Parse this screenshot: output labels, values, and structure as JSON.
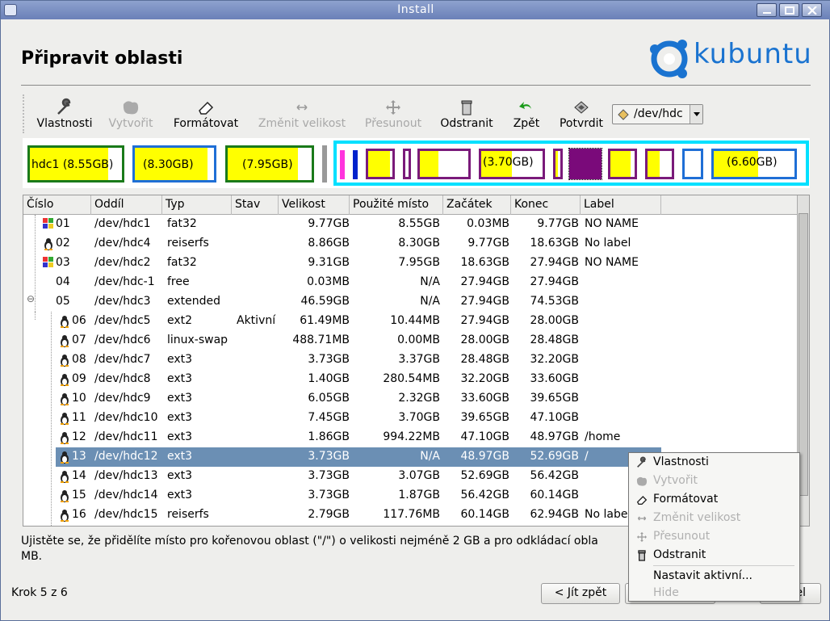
{
  "window": {
    "title": "Install"
  },
  "page": {
    "heading": "Připravit oblasti",
    "logo_text": "kubuntu"
  },
  "toolbar": {
    "items": [
      {
        "label": "Vlastnosti",
        "icon": "wrench-icon",
        "enabled": true
      },
      {
        "label": "Vytvořit",
        "icon": "create-partition-icon",
        "enabled": false
      },
      {
        "label": "Formátovat",
        "icon": "eraser-icon",
        "enabled": true
      },
      {
        "label": "Změnit velikost",
        "icon": "resize-icon",
        "enabled": false
      },
      {
        "label": "Přesunout",
        "icon": "move-icon",
        "enabled": false
      },
      {
        "label": "Odstranit",
        "icon": "trash-icon",
        "enabled": true
      },
      {
        "label": "Zpět",
        "icon": "undo-icon",
        "enabled": true
      },
      {
        "label": "Potvrdit",
        "icon": "apply-icon",
        "enabled": true
      }
    ],
    "device": "/dev/hdc"
  },
  "partition_map": {
    "labels": [
      "hdc1 (8.55GB)",
      "(8.30GB)",
      "(7.95GB)",
      "(3.70GB)",
      "(6.60GB)"
    ]
  },
  "table": {
    "columns": [
      "Číslo",
      "Oddíl",
      "Typ",
      "Stav",
      "Velikost",
      "Použité místo",
      "Začátek",
      "Konec",
      "Label"
    ],
    "rows": [
      {
        "num": "01",
        "part": "/dev/hdc1",
        "type": "fat32",
        "state": "",
        "size": "9.77GB",
        "used": "8.55GB",
        "start": "0.03MB",
        "end": "9.77GB",
        "label": "NO NAME",
        "icon": "windows-icon"
      },
      {
        "num": "02",
        "part": "/dev/hdc4",
        "type": "reiserfs",
        "state": "",
        "size": "8.86GB",
        "used": "8.30GB",
        "start": "9.77GB",
        "end": "18.63GB",
        "label": "No label",
        "icon": "linux-icon"
      },
      {
        "num": "03",
        "part": "/dev/hdc2",
        "type": "fat32",
        "state": "",
        "size": "9.31GB",
        "used": "7.95GB",
        "start": "18.63GB",
        "end": "27.94GB",
        "label": "NO NAME",
        "icon": "windows-icon"
      },
      {
        "num": "04",
        "part": "/dev/hdc-1",
        "type": "free",
        "state": "",
        "size": "0.03MB",
        "used": "N/A",
        "start": "27.94GB",
        "end": "27.94GB",
        "label": "",
        "icon": ""
      },
      {
        "num": "05",
        "part": "/dev/hdc3",
        "type": "extended",
        "state": "",
        "size": "46.59GB",
        "used": "N/A",
        "start": "27.94GB",
        "end": "74.53GB",
        "label": "",
        "icon": ""
      },
      {
        "num": "06",
        "part": "/dev/hdc5",
        "type": "ext2",
        "state": "Aktivní",
        "size": "61.49MB",
        "used": "10.44MB",
        "start": "27.94GB",
        "end": "28.00GB",
        "label": "",
        "icon": "linux-icon"
      },
      {
        "num": "07",
        "part": "/dev/hdc6",
        "type": "linux-swap",
        "state": "",
        "size": "488.71MB",
        "used": "0.00MB",
        "start": "28.00GB",
        "end": "28.48GB",
        "label": "",
        "icon": "linux-icon"
      },
      {
        "num": "08",
        "part": "/dev/hdc7",
        "type": "ext3",
        "state": "",
        "size": "3.73GB",
        "used": "3.37GB",
        "start": "28.48GB",
        "end": "32.20GB",
        "label": "",
        "icon": "linux-icon"
      },
      {
        "num": "09",
        "part": "/dev/hdc8",
        "type": "ext3",
        "state": "",
        "size": "1.40GB",
        "used": "280.54MB",
        "start": "32.20GB",
        "end": "33.60GB",
        "label": "",
        "icon": "linux-icon"
      },
      {
        "num": "10",
        "part": "/dev/hdc9",
        "type": "ext3",
        "state": "",
        "size": "6.05GB",
        "used": "2.32GB",
        "start": "33.60GB",
        "end": "39.65GB",
        "label": "",
        "icon": "linux-icon"
      },
      {
        "num": "11",
        "part": "/dev/hdc10",
        "type": "ext3",
        "state": "",
        "size": "7.45GB",
        "used": "3.70GB",
        "start": "39.65GB",
        "end": "47.10GB",
        "label": "",
        "icon": "linux-icon"
      },
      {
        "num": "12",
        "part": "/dev/hdc11",
        "type": "ext3",
        "state": "",
        "size": "1.86GB",
        "used": "994.22MB",
        "start": "47.10GB",
        "end": "48.97GB",
        "label": "/home",
        "icon": "linux-icon"
      },
      {
        "num": "13",
        "part": "/dev/hdc12",
        "type": "ext3",
        "state": "",
        "size": "3.73GB",
        "used": "N/A",
        "start": "48.97GB",
        "end": "52.69GB",
        "label": "/",
        "icon": "linux-icon"
      },
      {
        "num": "14",
        "part": "/dev/hdc13",
        "type": "ext3",
        "state": "",
        "size": "3.73GB",
        "used": "3.07GB",
        "start": "52.69GB",
        "end": "56.42GB",
        "label": "",
        "icon": "linux-icon"
      },
      {
        "num": "15",
        "part": "/dev/hdc14",
        "type": "ext3",
        "state": "",
        "size": "3.73GB",
        "used": "1.87GB",
        "start": "56.42GB",
        "end": "60.14GB",
        "label": "",
        "icon": "linux-icon"
      },
      {
        "num": "16",
        "part": "/dev/hdc15",
        "type": "reiserfs",
        "state": "",
        "size": "2.79GB",
        "used": "117.76MB",
        "start": "60.14GB",
        "end": "62.94GB",
        "label": "No label",
        "icon": "linux-icon"
      }
    ]
  },
  "note": "Ujistěte se, že přidělíte místo pro kořenovou oblast (\"/\") o    velikosti nejméně 2 GB a pro odkládací obla",
  "note_line2": "MB.",
  "footer": {
    "step": "Krok 5 z 6",
    "back": "< Jít zpět",
    "next": "",
    "cancel_fragment": "el"
  },
  "context_menu": {
    "items": [
      {
        "label": "Vlastnosti",
        "icon": "wrench-icon",
        "enabled": true
      },
      {
        "label": "Vytvořit",
        "icon": "create-partition-icon",
        "enabled": false
      },
      {
        "label": "Formátovat",
        "icon": "eraser-icon",
        "enabled": true
      },
      {
        "label": "Změnit velikost",
        "icon": "resize-icon",
        "enabled": false
      },
      {
        "label": "Přesunout",
        "icon": "move-icon",
        "enabled": false
      },
      {
        "label": "Odstranit",
        "icon": "trash-icon",
        "enabled": true
      },
      {
        "label": "Nastavit aktivní...",
        "icon": "",
        "enabled": true
      },
      {
        "label": "Hide",
        "icon": "",
        "enabled": false
      }
    ]
  },
  "colors": {
    "selection": "#6b8fb4",
    "extended_border": "#00e0ff",
    "fat_border": "#1a7a1a",
    "reiser_border": "#1f6fd6",
    "ext3_border": "#7a1a7a",
    "used_fill": "#ffff00"
  }
}
